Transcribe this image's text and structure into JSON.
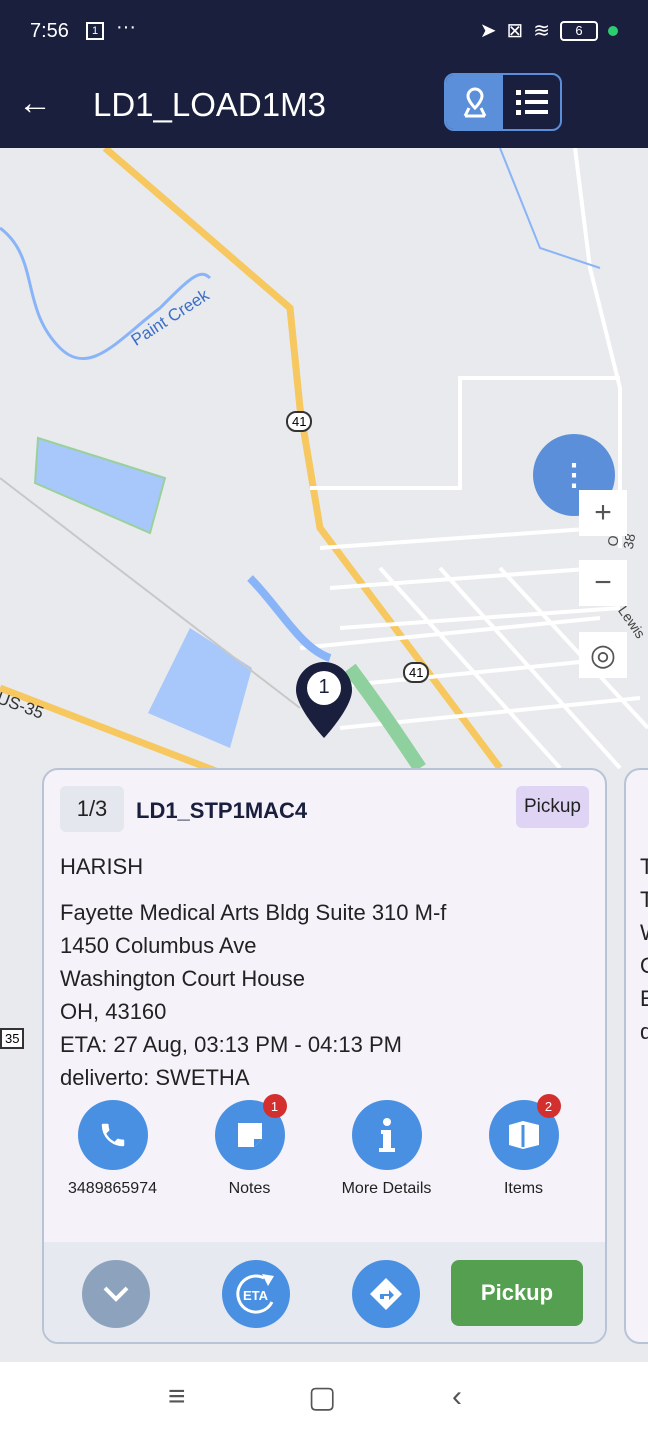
{
  "status_bar": {
    "time": "7:56",
    "calendar_day": "1",
    "battery": "6"
  },
  "header": {
    "title": "LD1_LOAD1M3",
    "view_toggle": {
      "active": "map"
    }
  },
  "map": {
    "labels": {
      "creek": "Paint Creek",
      "route_41a": "41",
      "route_41b": "41",
      "route_35": "35",
      "us35": "US-35",
      "old_road": "Old SR 38",
      "lewis": "Lewis"
    },
    "marker_number": "1",
    "zoom_in": "+",
    "zoom_out": "−"
  },
  "stop_card": {
    "sequence": "1/3",
    "stop_id": "LD1_STP1MAC4",
    "type_badge": "Pickup",
    "contact_name": "HARISH",
    "address_lines": [
      "Fayette Medical Arts Bldg Suite 310 M-f",
      "1450 Columbus Ave",
      "Washington Court House",
      "OH, 43160"
    ],
    "eta": "ETA: 27 Aug, 03:13 PM - 04:13 PM",
    "deliver_to": "deliverto: SWETHA",
    "actions": [
      {
        "label": "3489865974",
        "icon": "phone-icon"
      },
      {
        "label": "Notes",
        "icon": "note-icon",
        "badge": "1"
      },
      {
        "label": "More Details",
        "icon": "info-icon"
      },
      {
        "label": "Items",
        "icon": "box-icon",
        "badge": "2"
      }
    ],
    "pickup_button": "Pickup"
  },
  "next_card_partial": {
    "lines": [
      "T",
      "T",
      "W",
      "O",
      "E",
      "d"
    ]
  },
  "colors": {
    "header": "#1a1f3d",
    "accent": "#4a90e2",
    "pickup": "#55a050",
    "badge": "#d32f2f"
  }
}
